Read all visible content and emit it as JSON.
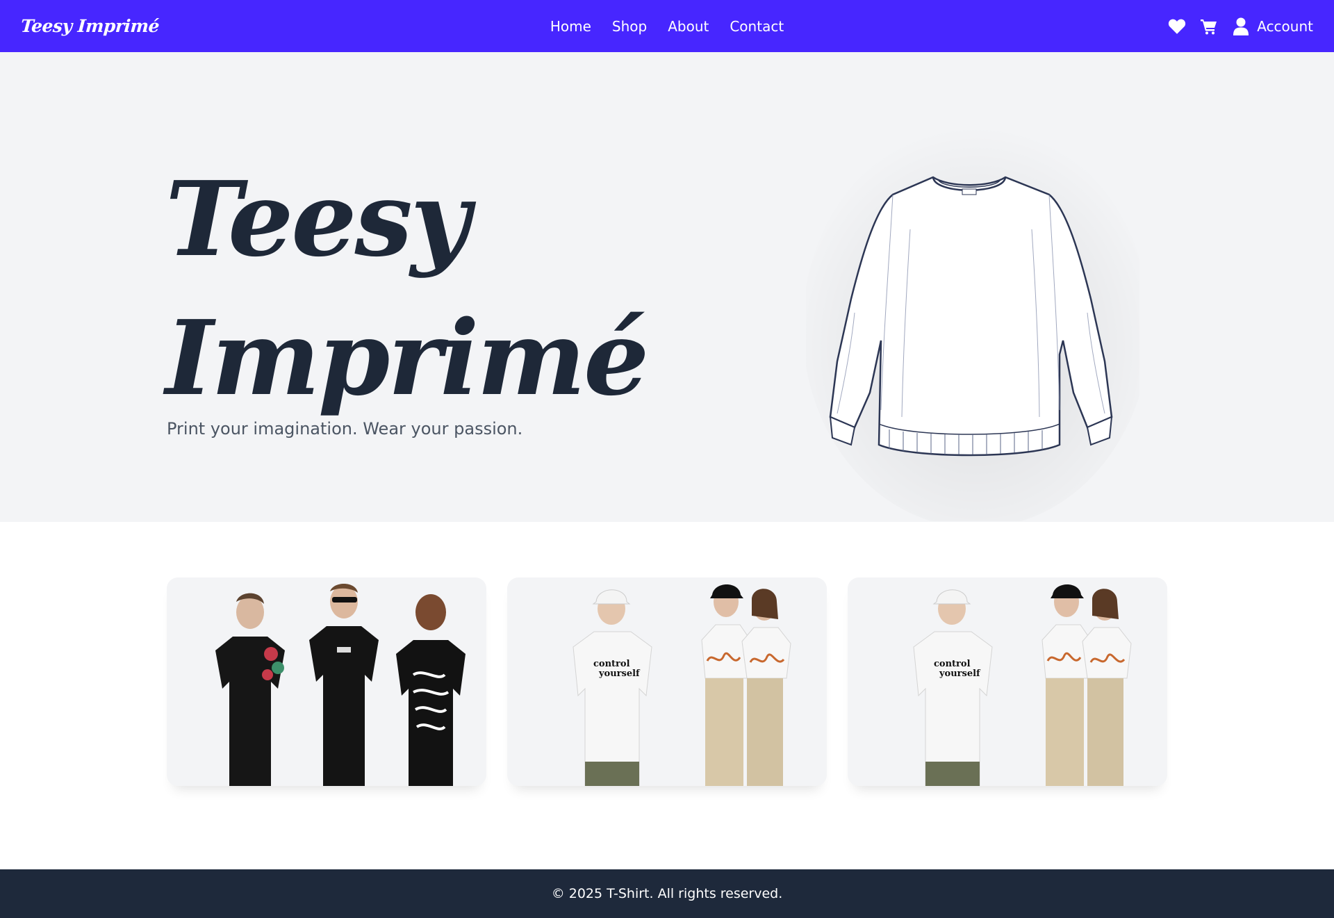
{
  "header": {
    "brand": "Teesy Imprimé",
    "nav": [
      "Home",
      "Shop",
      "About",
      "Contact"
    ],
    "account_label": "Account",
    "icons": [
      "heart-icon",
      "cart-icon",
      "user-icon"
    ]
  },
  "hero": {
    "title_line1": "Teesy",
    "title_line2": "Imprimé",
    "subtitle": "Print your imagination. Wear your passion.",
    "image": "sketched white sweatshirt"
  },
  "products": [
    {
      "image": "three models in black graphic t-shirts"
    },
    {
      "image": "models in white 'control yourself' t-shirts"
    },
    {
      "image": "models in white 'control yourself' t-shirts"
    }
  ],
  "footer": {
    "copyright": "© 2025 T-Shirt. All rights reserved."
  },
  "colors": {
    "primary": "#4726ff",
    "hero_bg": "#f3f4f6",
    "heading": "#1e2838",
    "footer_bg": "#1e293b"
  }
}
